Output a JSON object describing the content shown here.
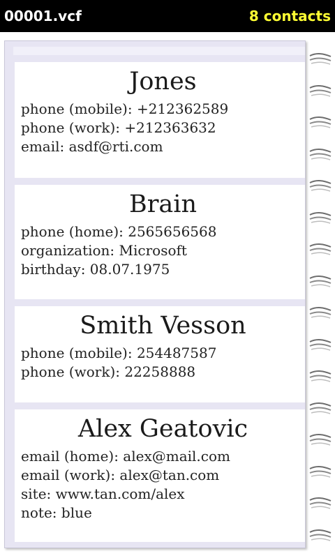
{
  "header": {
    "filename": "00001.vcf",
    "contacts_label": "8 contacts"
  },
  "colors": {
    "header_bg": "#000000",
    "filename_text": "#ffffff",
    "count_text": "#ffff33",
    "page_bg": "#e7e5f3",
    "card_bg": "#ffffff"
  },
  "contacts": [
    {
      "name": "Jones",
      "fields": [
        "phone (mobile): +212362589",
        "phone (work): +212363632",
        "email: asdf@rti.com"
      ]
    },
    {
      "name": "Brain",
      "fields": [
        "phone (home): 2565656568",
        "organization: Microsoft",
        "birthday: 08.07.1975"
      ]
    },
    {
      "name": "Smith Vesson",
      "fields": [
        "phone (mobile): 254487587",
        "phone (work): 22258888"
      ]
    },
    {
      "name": "Alex Geatovic",
      "fields": [
        "email (home): alex@mail.com",
        "email (work): alex@tan.com",
        "site: www.tan.com/alex",
        "note: blue"
      ]
    }
  ],
  "binding": {
    "icon": "spiral-ring-icon"
  }
}
